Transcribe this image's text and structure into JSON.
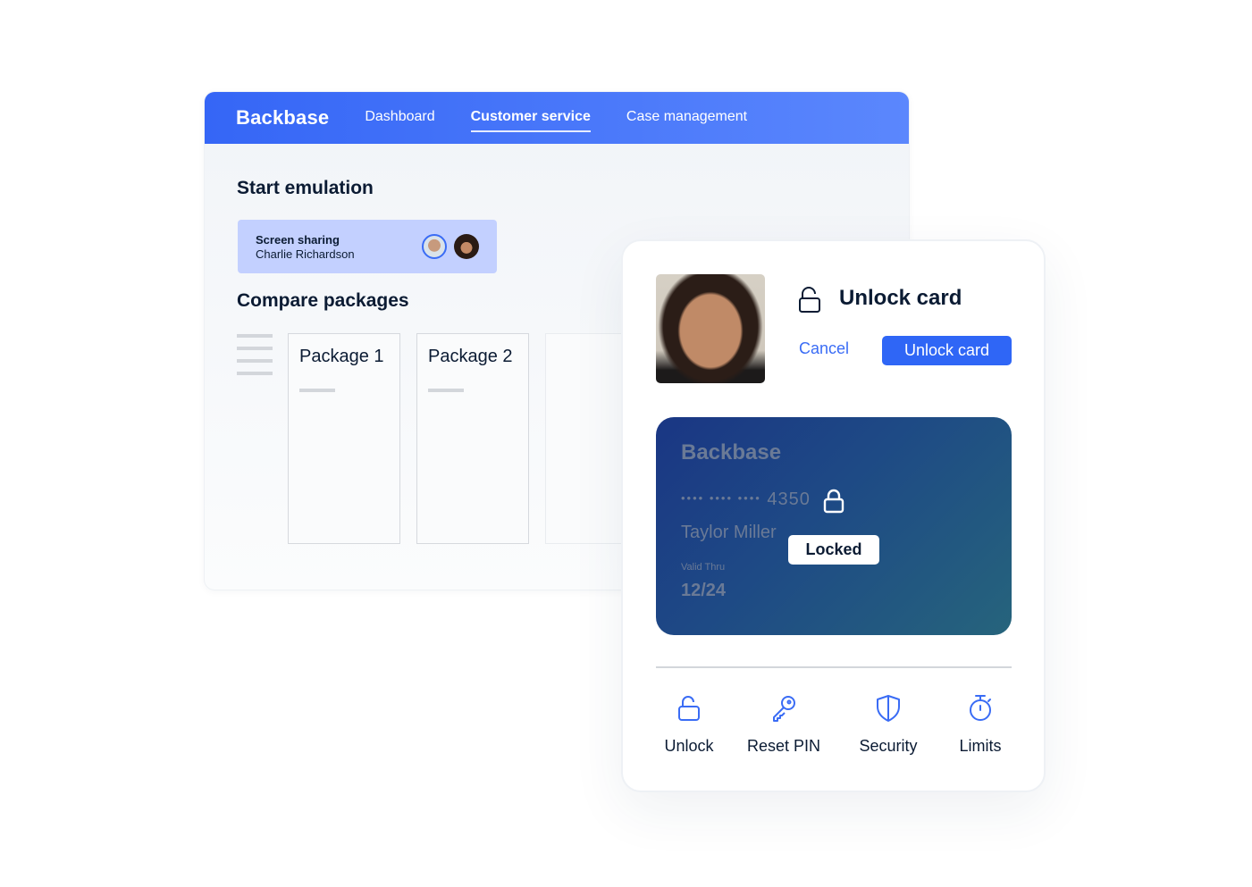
{
  "back_window": {
    "logo": "Backbase",
    "nav": [
      {
        "label": "Dashboard",
        "active": false
      },
      {
        "label": "Customer service",
        "active": true
      },
      {
        "label": "Case management",
        "active": false
      }
    ],
    "start_emulation_title": "Start emulation",
    "screen_sharing": {
      "title": "Screen sharing",
      "name": "Charlie Richardson"
    },
    "compare_packages_title": "Compare packages",
    "packages": [
      {
        "label": "Package 1"
      },
      {
        "label": "Package 2"
      },
      {
        "label": ""
      }
    ]
  },
  "unlock_panel": {
    "title": "Unlock card",
    "cancel_label": "Cancel",
    "unlock_button_label": "Unlock card",
    "card": {
      "brand": "Backbase",
      "masked_dots": "•••• •••• ••••",
      "last_digits": "4350",
      "holder": "Taylor Miller",
      "valid_label": "Valid Thru",
      "valid_value": "12/24",
      "status": "Locked"
    },
    "actions": [
      {
        "label": "Unlock",
        "icon": "unlock-icon"
      },
      {
        "label": "Reset PIN",
        "icon": "key-icon"
      },
      {
        "label": "Security",
        "icon": "shield-icon"
      },
      {
        "label": "Limits",
        "icon": "stopwatch-icon"
      }
    ]
  },
  "colors": {
    "accent": "#2f66f6",
    "topbar_start": "#3566f6",
    "topbar_end": "#5b87fd",
    "share_bg": "#c3d0ff",
    "text_dark": "#0b1b33",
    "card_start": "#1a3684",
    "card_end": "#26647c"
  }
}
